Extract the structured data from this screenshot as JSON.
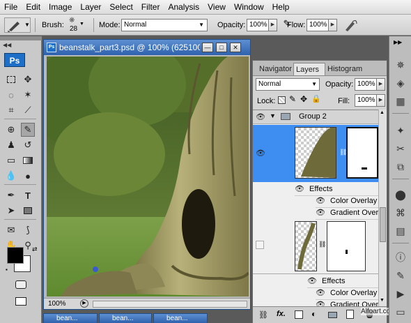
{
  "menu": [
    "File",
    "Edit",
    "Image",
    "Layer",
    "Select",
    "Filter",
    "Analysis",
    "View",
    "Window",
    "Help"
  ],
  "options": {
    "brush_label": "Brush:",
    "brush_size": "28",
    "mode_label": "Mode:",
    "mode_value": "Normal",
    "opacity_label": "Opacity:",
    "opacity_value": "100%",
    "flow_label": "Flow:",
    "flow_value": "100%"
  },
  "tools": {
    "logo": "Ps"
  },
  "document": {
    "title": "beanstalk_part3.psd @ 100% (625100...",
    "zoom": "100%"
  },
  "layers_panel": {
    "tabs": [
      "Navigator",
      "Layers",
      "Histogram"
    ],
    "close_glyph": "×",
    "blend_mode": "Normal",
    "opacity_label": "Opacity:",
    "opacity_value": "100%",
    "lock_label": "Lock:",
    "fill_label": "Fill:",
    "fill_value": "100%",
    "group_name": "Group 2",
    "effects_label_1": "Effects",
    "color_overlay_1": "Color Overlay",
    "gradient_overlay_1": "Gradient Over...",
    "effects_label_2": "Effects",
    "color_overlay_2": "Color Overlay",
    "gradient_overlay_2": "Gradient Over..."
  },
  "taskbar": {
    "items": [
      "bean...",
      "bean...",
      "bean..."
    ]
  },
  "watermark": "Alfoart.com",
  "colors": {
    "selection": "#3d8ef0",
    "title_blue": "#2e62ad",
    "foreground": "#000000",
    "background": "#ffffff"
  }
}
